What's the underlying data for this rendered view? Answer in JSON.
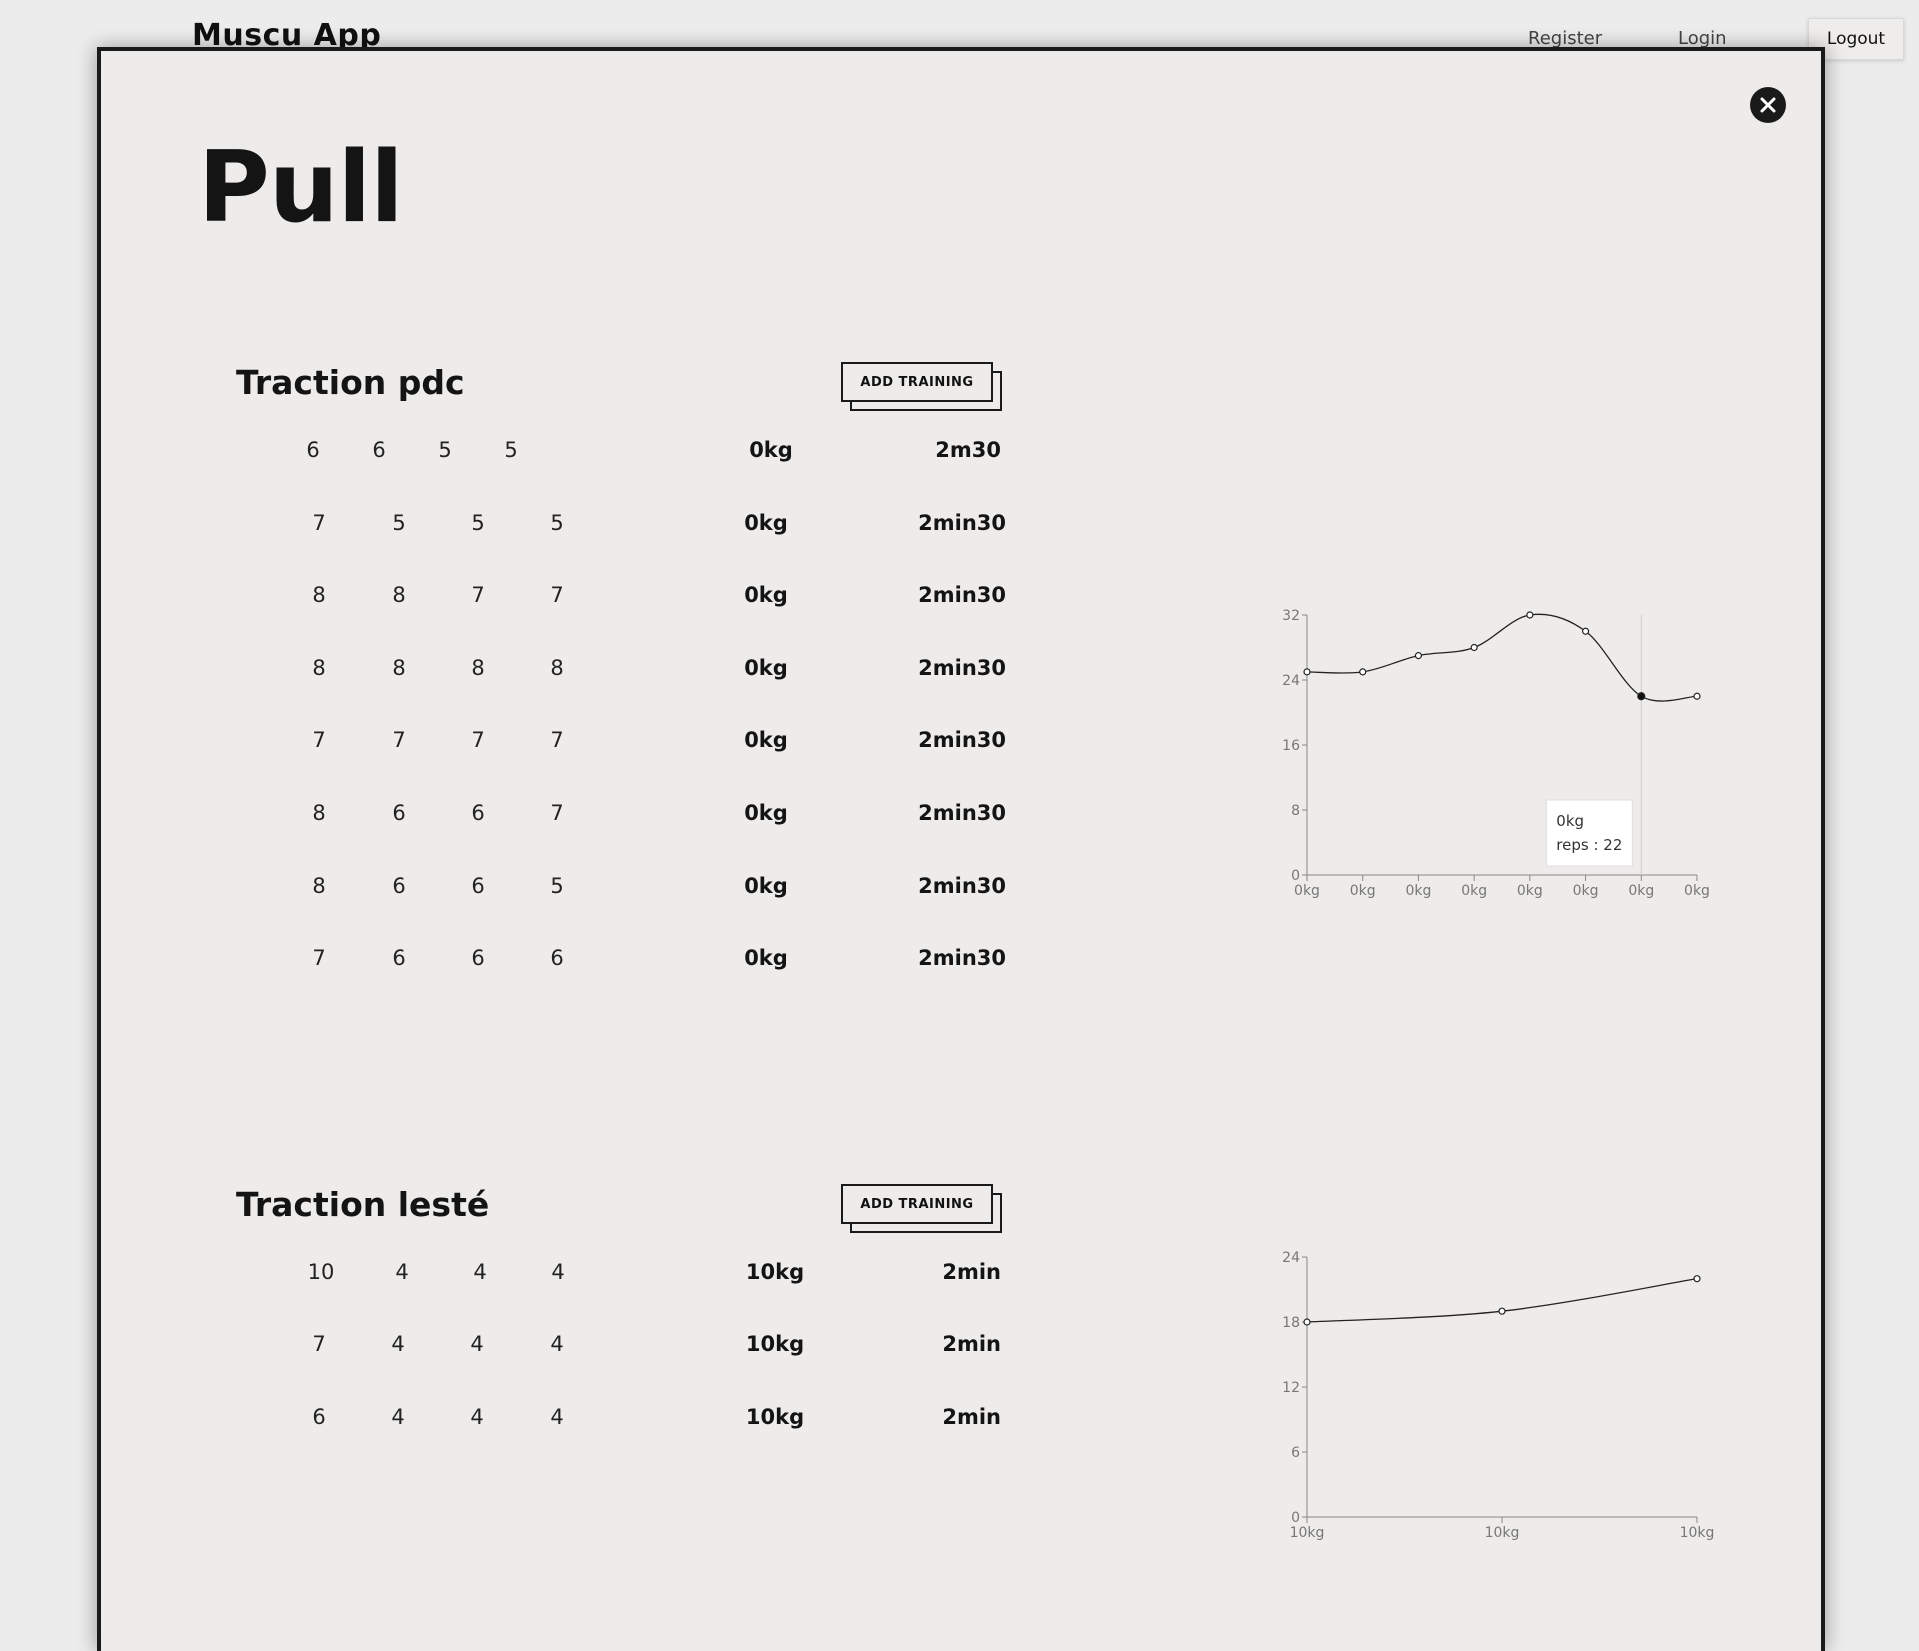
{
  "header": {
    "brand": "Muscu App",
    "nav": {
      "register": "Register",
      "login": "Login",
      "logout": "Logout"
    }
  },
  "modal": {
    "title": "Pull",
    "close_icon": "close-icon",
    "exercises": [
      {
        "name": "Traction pdc",
        "add_label": "ADD TRAINING",
        "rows": [
          {
            "reps": [
              "6",
              "6",
              "5",
              "5"
            ],
            "weight": "0kg",
            "rest": "2m30"
          },
          {
            "reps": [
              "7",
              "5",
              "5",
              "5"
            ],
            "weight": "0kg",
            "rest": "2min30"
          },
          {
            "reps": [
              "8",
              "8",
              "7",
              "7"
            ],
            "weight": "0kg",
            "rest": "2min30"
          },
          {
            "reps": [
              "8",
              "8",
              "8",
              "8"
            ],
            "weight": "0kg",
            "rest": "2min30"
          },
          {
            "reps": [
              "7",
              "7",
              "7",
              "7"
            ],
            "weight": "0kg",
            "rest": "2min30"
          },
          {
            "reps": [
              "8",
              "6",
              "6",
              "7"
            ],
            "weight": "0kg",
            "rest": "2min30"
          },
          {
            "reps": [
              "8",
              "6",
              "6",
              "5"
            ],
            "weight": "0kg",
            "rest": "2min30"
          },
          {
            "reps": [
              "7",
              "6",
              "6",
              "6"
            ],
            "weight": "0kg",
            "rest": "2min30"
          }
        ]
      },
      {
        "name": "Traction lesté",
        "add_label": "ADD TRAINING",
        "rows": [
          {
            "reps": [
              "10",
              "4",
              "4",
              "4"
            ],
            "weight": "10kg",
            "rest": "2min"
          },
          {
            "reps": [
              "7",
              "4",
              "4",
              "4"
            ],
            "weight": "10kg",
            "rest": "2min"
          },
          {
            "reps": [
              "6",
              "4",
              "4",
              "4"
            ],
            "weight": "10kg",
            "rest": "2min"
          }
        ]
      }
    ]
  },
  "chart_data": [
    {
      "type": "line",
      "title": "",
      "xlabel": "",
      "ylabel": "",
      "x": [
        "0kg",
        "0kg",
        "0kg",
        "0kg",
        "0kg",
        "0kg",
        "0kg",
        "0kg"
      ],
      "series": [
        {
          "values": [
            25,
            25,
            27,
            28,
            32,
            30,
            22,
            22
          ]
        }
      ],
      "ylim": [
        0,
        32
      ],
      "yticks": [
        "0",
        "8",
        "16",
        "24",
        "32"
      ],
      "grid": false,
      "tooltip": {
        "line1": "0kg",
        "line2": "reps : 22",
        "index": 6
      }
    },
    {
      "type": "line",
      "title": "",
      "xlabel": "",
      "ylabel": "",
      "x": [
        "10kg",
        "10kg",
        "10kg"
      ],
      "series": [
        {
          "values": [
            18,
            19,
            22
          ]
        }
      ],
      "ylim": [
        0,
        24
      ],
      "yticks": [
        "0",
        "6",
        "12",
        "18",
        "24"
      ],
      "grid": false
    }
  ]
}
